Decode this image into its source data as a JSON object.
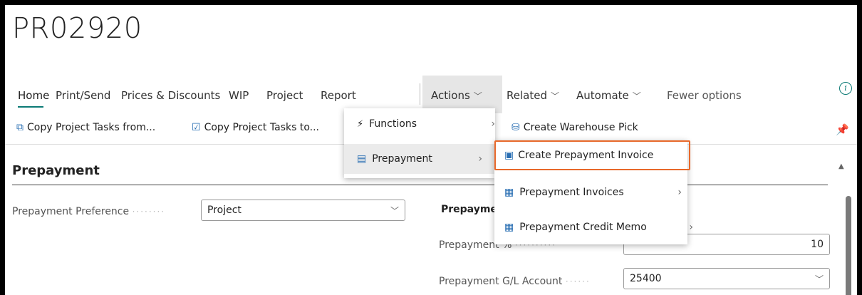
{
  "page": {
    "title": "PR02920"
  },
  "tabs": [
    {
      "label": "Home"
    },
    {
      "label": "Print/Send"
    },
    {
      "label": "Prices & Discounts"
    },
    {
      "label": "WIP"
    },
    {
      "label": "Project"
    },
    {
      "label": "Report"
    },
    {
      "label": "Actions"
    },
    {
      "label": "Related"
    },
    {
      "label": "Automate"
    },
    {
      "label": "Fewer options"
    }
  ],
  "actionbar": {
    "copy_from": "Copy Project Tasks from...",
    "copy_to": "Copy Project Tasks to...",
    "create_pick": "Create Warehouse Pick"
  },
  "section": {
    "title": "Prepayment",
    "pref_label": "Prepayment Preference",
    "pref_value": "Project",
    "right_heading": "Prepaymer",
    "pct_label": "Prepayment %",
    "pct_value": "10",
    "gl_label": "Prepayment G/L Account",
    "gl_value": "25400"
  },
  "menu_actions": [
    {
      "label": "Functions"
    },
    {
      "label": "Prepayment"
    }
  ],
  "menu_prepayment": [
    {
      "label": "Create Prepayment Invoice"
    },
    {
      "label": "Prepayment Invoices"
    },
    {
      "label": "Prepayment Credit Memo"
    }
  ],
  "colors": {
    "accent": "#0b7a75",
    "highlight": "#e8692b",
    "icon_blue": "#2a6fb3"
  }
}
